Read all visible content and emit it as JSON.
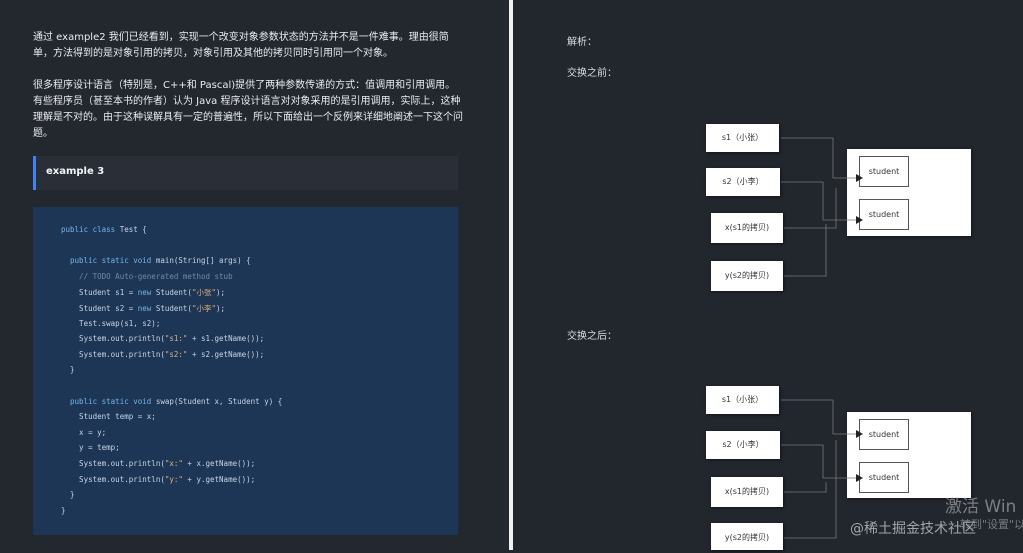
{
  "left": {
    "para1": "通过 example2 我们已经看到，实现一个改变对象参数状态的方法并不是一件难事。理由很简单，方法得到的是对象引用的拷贝，对象引用及其他的拷贝同时引用同一个对象。",
    "para2": "很多程序设计语言（特别是，C++和 Pascal)提供了两种参数传递的方式：值调用和引用调用。有些程序员（甚至本书的作者）认为 Java 程序设计语言对对象采用的是引用调用，实际上，这种理解是不对的。由于这种误解具有一定的普遍性，所以下面给出一个反例来详细地阐述一下这个问题。",
    "callout": "example 3",
    "code": [
      "public class Test {",
      "",
      "  public static void main(String[] args) {",
      "    // TODO Auto-generated method stub",
      "    Student s1 = new Student(\"小张\");",
      "    Student s2 = new Student(\"小李\");",
      "    Test.swap(s1, s2);",
      "    System.out.println(\"s1:\" + s1.getName());",
      "    System.out.println(\"s2:\" + s2.getName());",
      "  }",
      "",
      "  public static void swap(Student x, Student y) {",
      "    Student temp = x;",
      "    x = y;",
      "    y = temp;",
      "    System.out.println(\"x:\" + x.getName());",
      "    System.out.println(\"y:\" + y.getName());",
      "  }",
      "}"
    ]
  },
  "right": {
    "analysis": "解析：",
    "before": "交换之前：",
    "after": "交换之后：",
    "diagram1": {
      "vars": [
        "s1（小张）",
        "s2（小李）",
        "x(s1的拷贝)",
        "y(s2的拷贝)"
      ],
      "objects": [
        "student",
        "student"
      ]
    },
    "diagram2": {
      "vars": [
        "s1（小张）",
        "s2（小李）",
        "x(s1的拷贝)",
        "y(s2的拷贝)"
      ],
      "objects": [
        "student",
        "student"
      ]
    }
  },
  "watermark": {
    "activate_title": "激活 Win",
    "activate_sub": "转到\"设置\"以",
    "site": "@稀土掘金技术社区"
  }
}
